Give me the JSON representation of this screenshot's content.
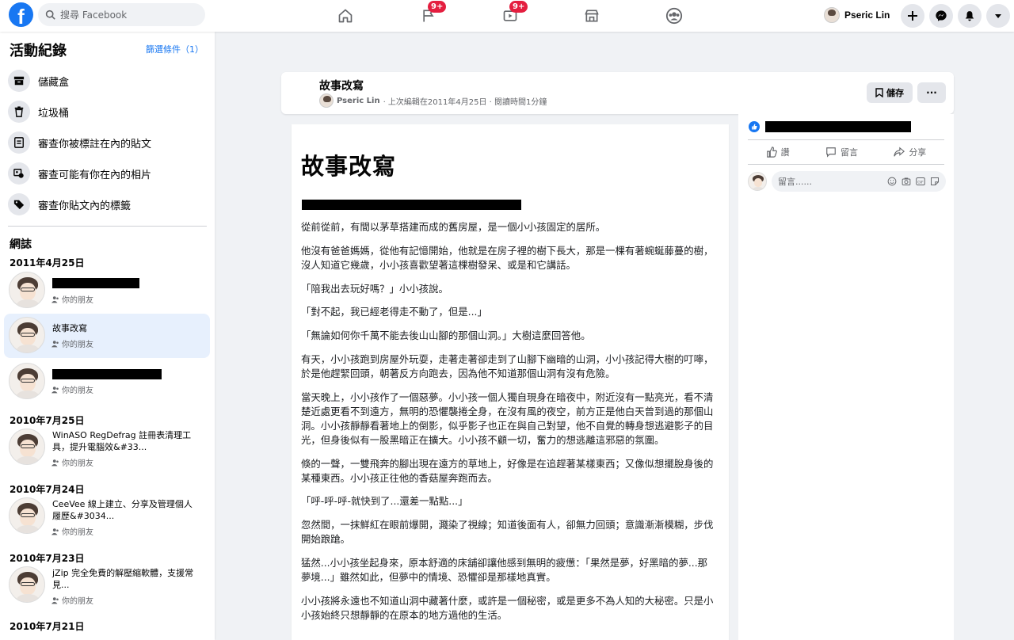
{
  "topbar": {
    "logo": "f",
    "search_placeholder": "搜尋 Facebook",
    "nav_badges": [
      "9+",
      "9+"
    ],
    "profile_name": "Pseric Lin"
  },
  "sidebar": {
    "title": "活動紀錄",
    "filter_label": "篩選條件（1）",
    "menu": [
      {
        "label": "儲藏盒",
        "icon": "archive-icon"
      },
      {
        "label": "垃圾桶",
        "icon": "trash-icon"
      },
      {
        "label": "審查你被標註在內的貼文",
        "icon": "tag-post-icon"
      },
      {
        "label": "審查可能有你在內的相片",
        "icon": "photo-review-icon"
      },
      {
        "label": "審查你貼文內的標籤",
        "icon": "label-icon"
      }
    ],
    "section_title": "網誌",
    "groups": [
      {
        "date": "2011年4月25日"
      },
      {
        "date": "2010年7月25日"
      },
      {
        "date": "2010年7月24日"
      },
      {
        "date": "2010年7月23日"
      },
      {
        "date": "2010年7月21日"
      }
    ],
    "entries": [
      {
        "title": "",
        "audience": "你的朋友"
      },
      {
        "title": "故事改寫",
        "audience": "你的朋友"
      },
      {
        "title": "",
        "audience": "你的朋友"
      },
      {
        "title": "WinASO RegDefrag 註冊表清理工具，提升電腦效&#33...",
        "audience": "你的朋友"
      },
      {
        "title": "CeeVee 線上建立、分享及管理個人履歷&#3034...",
        "audience": "你的朋友"
      },
      {
        "title": "jZip 完全免費的解壓縮軟體，支援常見...",
        "audience": "你的朋友"
      }
    ]
  },
  "header_card": {
    "title": "故事改寫",
    "author": "Pseric Lin",
    "meta": "· 上次編輯在2011年4月25日 · 閱讀時間1分鐘",
    "save_label": "儲存",
    "more_label": "···"
  },
  "article": {
    "title": "故事改寫",
    "paragraphs": [
      "從前從前，有間以茅草搭建而成的舊房屋，是一個小小孩固定的居所。",
      "他沒有爸爸媽媽，從他有記憶開始，他就是在房子裡的樹下長大，那是一棵有著蜿蜒藤蔓的樹，沒人知道它幾歲，小小孩喜歡望著這棵樹發呆、或是和它講話。",
      "「陪我出去玩好嗎？」小小孩說。",
      "「對不起，我已經老得走不動了，但是...」",
      "「無論如何你千萬不能去後山山腳的那個山洞。」大樹這麼回答他。",
      "有天，小小孩跑到房屋外玩耍，走著走著卻走到了山腳下幽暗的山洞，小小孩記得大樹的叮嚀，於是他趕緊回頭，朝著反方向跑去，因為他不知道那個山洞有沒有危險。",
      "當天晚上，小小孩作了一個惡夢。小小孩一個人獨自現身在暗夜中，附近沒有一點亮光，看不清楚近處更看不到遠方，無明的恐懼襲捲全身，在沒有風的夜空，前方正是他白天曾到過的那個山洞。小小孩靜靜看著地上的倒影，似乎影子也正在與自己對望，他不自覺的轉身想逃避影子的目光，但身後似有一股黑暗正在擴大。小小孩不顧一切，奮力的想逃離這邪惡的氛圍。",
      "倏的一聲，一雙飛奔的腳出現在遠方的草地上，好像是在追趕著某樣東西；又像似想擺脫身後的某種東西。小小孩正往他的香菇屋奔跑而去。",
      "「呼-呼-呼-就快到了...還差一點點...」",
      "忽然間，一抹鮮紅在眼前爆開，濺染了視線；知道後面有人，卻無力回頭；意識漸漸模糊，步伐開始踉蹌。",
      "猛然...小小孩坐起身來，原本舒適的床舖卻讓他感到無明的疲憊：「果然是夢，好黑暗的夢...那夢境...」雖然如此，但夢中的情境、恐懼卻是那樣地真實。",
      "小小孩將永遠也不知道山洞中藏著什麼，或許是一個秘密，或是更多不為人知的大秘密。只是小小孩始終只想靜靜的在原本的地方過他的生活。"
    ]
  },
  "right_panel": {
    "actions": [
      "讚",
      "留言",
      "分享"
    ],
    "comment_placeholder": "留言......"
  },
  "colors": {
    "brand": "#1877f2",
    "badge": "#e41e3f",
    "page_bg": "#f0f2f5"
  }
}
